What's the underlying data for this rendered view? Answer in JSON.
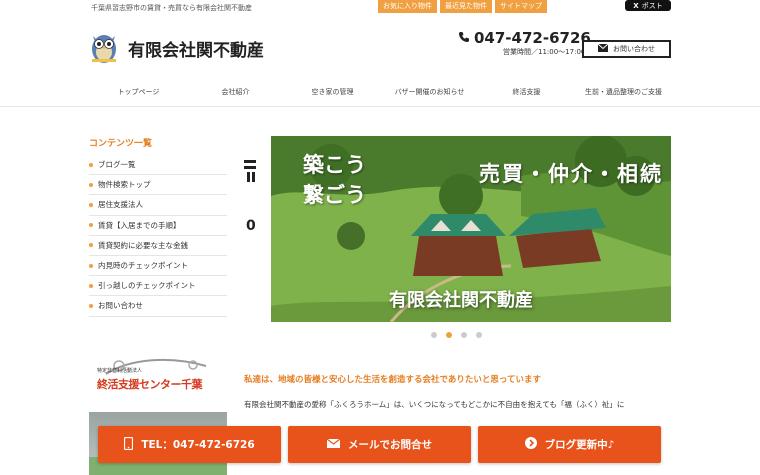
{
  "header": {
    "tagline": "千葉県習志野市の賃貸・売買なら有限会社関不動産",
    "top_links": [
      "お気に入り物件",
      "最近見た物件",
      "サイトマップ"
    ],
    "x_post_label": "ポスト",
    "company_name": "有限会社関不動産",
    "phone": "047-472-6726",
    "hours": "営業時間／11:00～17:00",
    "contact_label": "お問い合わせ"
  },
  "nav": {
    "items": [
      "トップページ",
      "会社紹介",
      "空き家の管理",
      "バザー開催のお知らせ",
      "終活支援",
      "生前・遺品整理のご支援"
    ]
  },
  "sidebar": {
    "heading": "コンテンツ一覧",
    "items": [
      "ブログ一覧",
      "物件検索トップ",
      "居住支援法人",
      "賃貸【入居までの手順】",
      "賃貸契約に必要な主な金銭",
      "内見時のチェックポイント",
      "引っ越しのチェックポイント",
      "お問い合わせ"
    ],
    "banner_small": "特定非営利活動法人",
    "banner_big": "終活支援センター千葉"
  },
  "hero": {
    "left_digit": "0",
    "catch": "築こう\n繋ごう",
    "right_text": "売買・仲介・相続",
    "company": "有限会社関不動産",
    "dots": 4,
    "active_dot": 1
  },
  "intro": {
    "heading": "私達は、地域の皆様と安心した生活を創造する会社でありたいと思っています",
    "body": "有限会社関不動産の愛称「ふくろうホーム」は、いくつになってもどこかに不自由を抱えても「福（ふく）祉」に"
  },
  "cta": {
    "phone_label": "TEL：047-472-6726",
    "mail_label": "メールでお問合せ",
    "blog_label": "ブログ更新中♪"
  },
  "colors": {
    "accent": "#f0a040",
    "heading": "#e67e22",
    "cta": "#e8531c"
  }
}
